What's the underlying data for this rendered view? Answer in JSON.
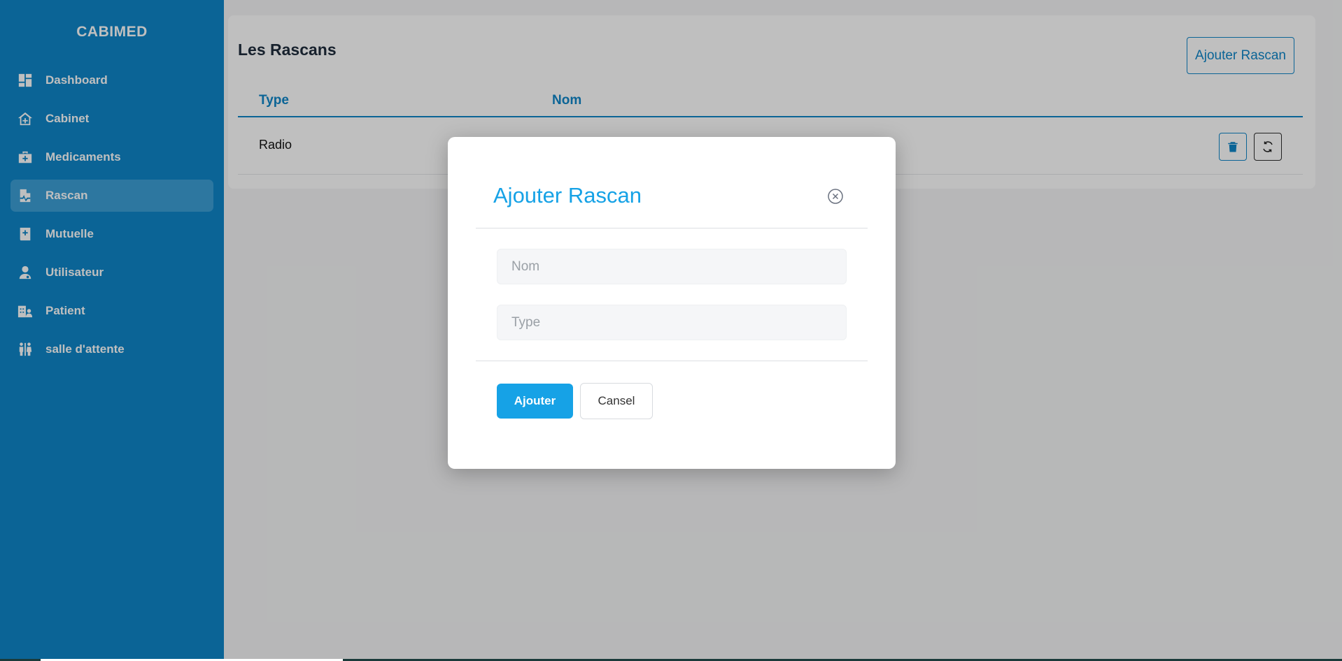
{
  "sidebar": {
    "brand": "CABIMED",
    "items": [
      {
        "label": "Dashboard",
        "icon": "dashboard-icon"
      },
      {
        "label": "Cabinet",
        "icon": "home-plus-icon"
      },
      {
        "label": "Medicaments",
        "icon": "medkit-icon"
      },
      {
        "label": "Rascan",
        "icon": "file-waveform-icon",
        "active": true
      },
      {
        "label": "Mutuelle",
        "icon": "book-medical-icon"
      },
      {
        "label": "Utilisateur",
        "icon": "user-doctor-icon"
      },
      {
        "label": "Patient",
        "icon": "hospital-user-icon"
      },
      {
        "label": "salle d'attente",
        "icon": "people-icon"
      }
    ]
  },
  "page": {
    "title": "Les Rascans",
    "add_button": "Ajouter Rascan"
  },
  "table": {
    "columns": [
      "Type",
      "Nom"
    ],
    "rows": [
      {
        "type": "Radio",
        "nom": ""
      }
    ],
    "actions": [
      "trash-icon",
      "refresh-icon"
    ]
  },
  "modal": {
    "title": "Ajouter Rascan",
    "close_icon": "circle-x-icon",
    "fields": {
      "nom": {
        "placeholder": "Nom",
        "value": ""
      },
      "type": {
        "placeholder": "Type",
        "value": ""
      }
    },
    "submit_label": "Ajouter",
    "cancel_label": "Cansel"
  },
  "colors": {
    "sidebar": "#0f86c8",
    "accent": "#16a2e6",
    "overlay": "rgba(0,0,0,0.25)"
  }
}
